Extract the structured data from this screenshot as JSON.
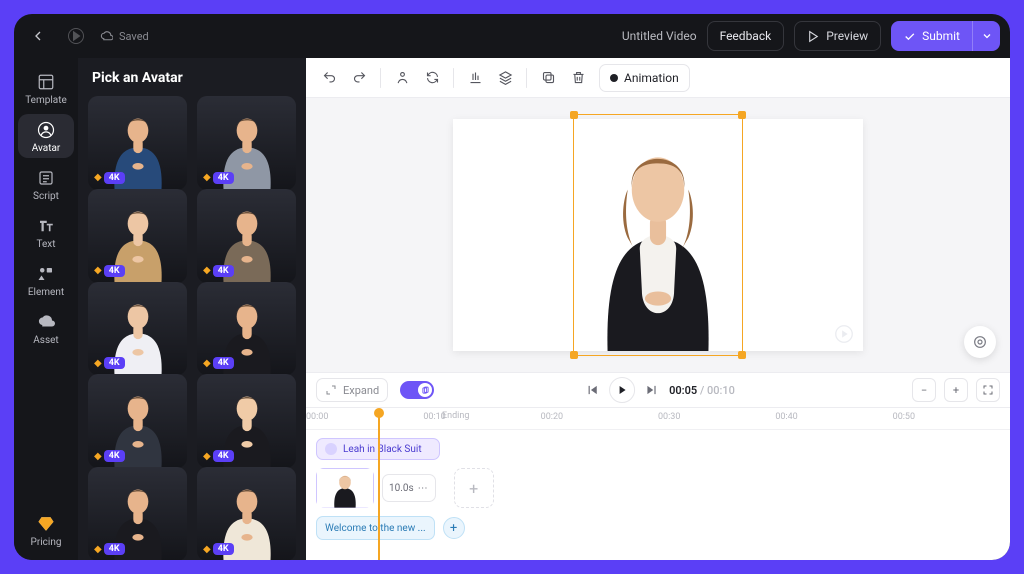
{
  "header": {
    "saved_label": "Saved",
    "title": "Untitled Video",
    "feedback_label": "Feedback",
    "preview_label": "Preview",
    "submit_label": "Submit"
  },
  "rail": {
    "items": [
      {
        "id": "template",
        "label": "Template"
      },
      {
        "id": "avatar",
        "label": "Avatar"
      },
      {
        "id": "script",
        "label": "Script"
      },
      {
        "id": "text",
        "label": "Text"
      },
      {
        "id": "element",
        "label": "Element"
      },
      {
        "id": "asset",
        "label": "Asset"
      }
    ],
    "pricing_label": "Pricing"
  },
  "panel": {
    "title": "Pick an Avatar",
    "badge_label": "4K",
    "avatars": [
      {
        "shirt": "#274a7a",
        "skin": "#e7b48c"
      },
      {
        "shirt": "#8f97a5",
        "skin": "#e7b48c"
      },
      {
        "shirt": "#c8a06a",
        "skin": "#edc6a4"
      },
      {
        "shirt": "#7a6a58",
        "skin": "#e7b48c"
      },
      {
        "shirt": "#efeff4",
        "skin": "#edc6a4"
      },
      {
        "shirt": "#1a1a1f",
        "skin": "#e7b48c"
      },
      {
        "shirt": "#303540",
        "skin": "#e7b48c"
      },
      {
        "shirt": "#1a1a1f",
        "skin": "#f0cba7"
      },
      {
        "shirt": "#1a1a1f",
        "skin": "#e7b48c"
      },
      {
        "shirt": "#efe7d8",
        "skin": "#e7b48c"
      }
    ]
  },
  "canvas": {
    "animation_label": "Animation"
  },
  "transport": {
    "expand_label": "Expand",
    "current": "00:05",
    "total": "00:10"
  },
  "timeline": {
    "marks": [
      "00:00",
      "00:10",
      "00:20",
      "00:30",
      "00:40",
      "00:50"
    ],
    "ending_label": "Ending",
    "clip_name": "Leah in Black Suit",
    "clip_index": "1",
    "duration_chip": "10.0s",
    "caption_text": "Welcome to the new ..."
  }
}
